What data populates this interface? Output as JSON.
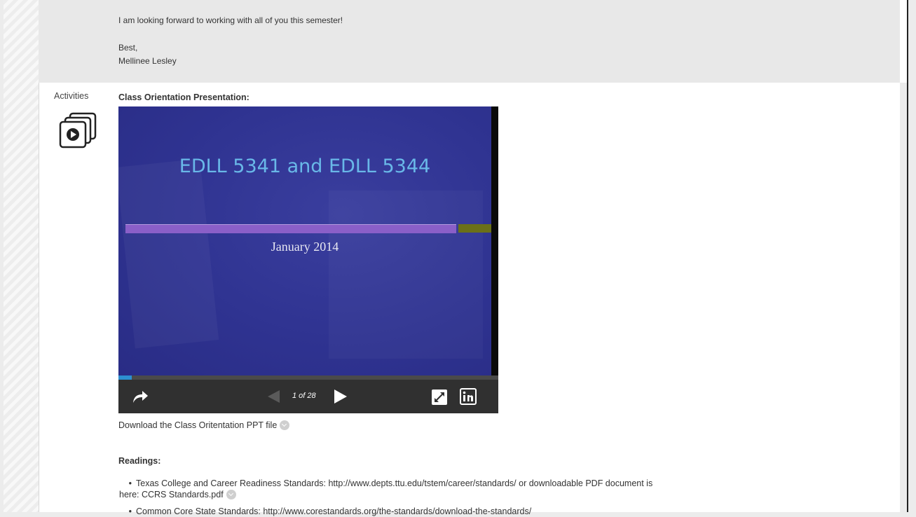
{
  "message": {
    "line1": "I am looking forward to working with all of you this semester!",
    "closing": "Best,",
    "signature": "Mellinee Lesley"
  },
  "activities": {
    "label": "Activities",
    "icon": "activity-slides-icon"
  },
  "presentation": {
    "heading": "Class Orientation Presentation:",
    "slide_title": "EDLL 5341 and EDLL 5344",
    "slide_subtitle": "January 2014",
    "page_counter": "1 of 28",
    "progress": 0.035,
    "colors": {
      "slide_bg": "#2f3391",
      "title": "#69b8e8",
      "bar": "#8a5fc8",
      "bar_accent": "#6b7018",
      "progress": "#2d8fd0",
      "controls_bg": "#303030"
    },
    "controls": {
      "share_icon": "share-arrow-icon",
      "prev_icon": "triangle-left-icon",
      "next_icon": "triangle-right-icon",
      "fullscreen_icon": "expand-icon",
      "linkedin_icon": "linkedin-icon"
    }
  },
  "download": {
    "text": "Download the Class Oritentation PPT file",
    "icon": "chevron-down-circle-icon"
  },
  "readings": {
    "heading": "Readings:",
    "items": [
      {
        "line1": "Texas College and Career Readiness Standards: http://www.depts.ttu.edu/tstem/career/standards/ or downloadable PDF document is",
        "line2": "here: CCRS Standards.pdf"
      },
      {
        "line1": "Common Core State Standards: http://www.corestandards.org/the-standards/download-the-standards/"
      }
    ]
  }
}
